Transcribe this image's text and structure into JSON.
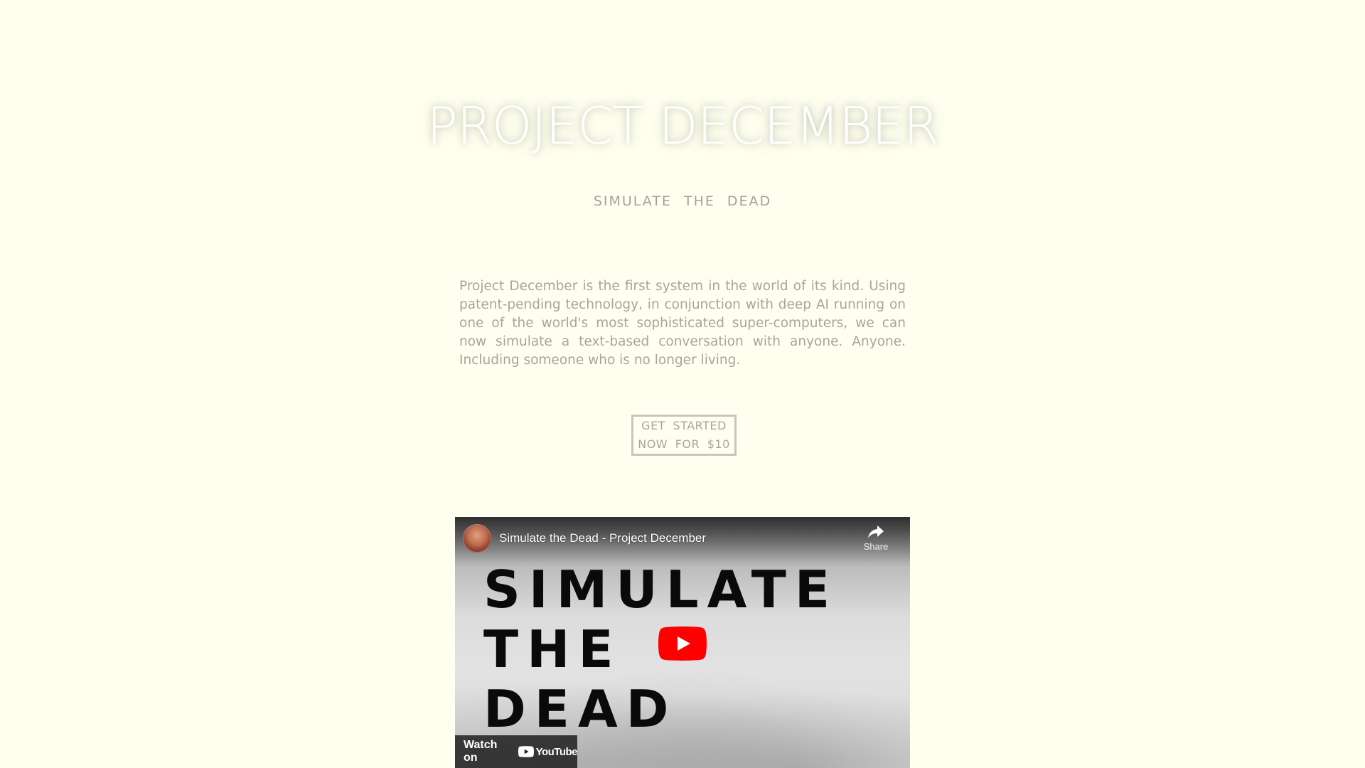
{
  "hero": {
    "title": "PROJECT DECEMBER",
    "subtitle": "SIMULATE THE DEAD"
  },
  "intro": {
    "text": "Project December is the first system in the world of its kind. Using patent-pending technology, in conjunction with deep AI running on one of the world's most sophisticated super-computers, we can now simulate a text-based conversation with anyone. Anyone. Including someone who is no longer living."
  },
  "cta": {
    "label": "GET STARTED NOW FOR $10"
  },
  "video": {
    "title": "Simulate the Dead - Project December",
    "share_label": "Share",
    "poster_lines": [
      "SIMULATE",
      "THE",
      "DEAD"
    ],
    "watch_label": "Watch on",
    "platform_name": "YouTube",
    "icons": {
      "avatar": "channel-avatar",
      "share": "share-arrow-icon",
      "play": "play-icon",
      "logo": "youtube-logo-icon"
    },
    "colors": {
      "play_button": "#ff0000",
      "watch_bar": "#1e1e1e"
    }
  },
  "colors": {
    "background": "#fffff0",
    "title": "#ffffff",
    "body_text": "#a5a59d",
    "button_border": "#c6c6be"
  }
}
